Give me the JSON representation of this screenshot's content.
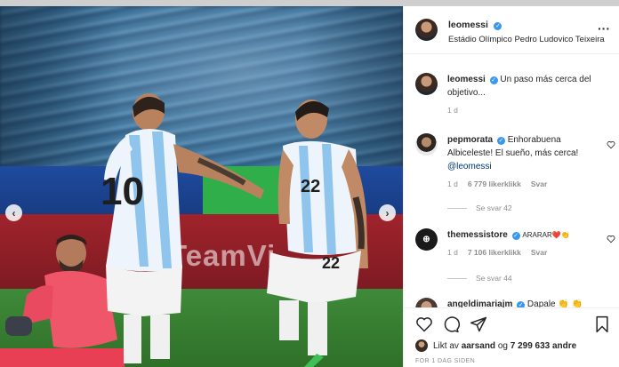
{
  "post": {
    "author": "leomessi",
    "location": "Estádio Olímpico Pedro Ludovico Teixeira",
    "image_board_text": "TeamVi",
    "shirt_numbers": [
      "10",
      "22",
      "22"
    ]
  },
  "caption": {
    "username": "leomessi",
    "text": "Un paso más cerca del objetivo...",
    "age": "1 d"
  },
  "comments": [
    {
      "username": "pepmorata",
      "text": "Enhorabuena Albiceleste! El sueño, más cerca!",
      "mention": "@leomessi",
      "age": "1 d",
      "likes": "6 779 likerklikk",
      "reply": "Svar",
      "see_replies": "Se svar 42"
    },
    {
      "username": "themessistore",
      "text": "ARARAR❤️👏",
      "age": "1 d",
      "likes": "7 106 likerklikk",
      "reply": "Svar",
      "see_replies": "Se svar 44"
    },
    {
      "username": "angeldimariajm",
      "text": "Dapale 👏 👏"
    }
  ],
  "likes": {
    "prefix": "Likt av",
    "user": "aarsand",
    "middle": "og",
    "count": "7 299 633 andre"
  },
  "time": "FOR 1 DAG SIDEN",
  "icons": {
    "more": "more-options-icon",
    "prev": "chevron-left-icon",
    "next": "chevron-right-icon",
    "like": "heart-icon",
    "comment": "comment-icon",
    "share": "share-icon",
    "save": "bookmark-icon"
  },
  "colors": {
    "verified": "#3897f0",
    "mention": "#00376b",
    "muted": "#8e8e8e"
  }
}
